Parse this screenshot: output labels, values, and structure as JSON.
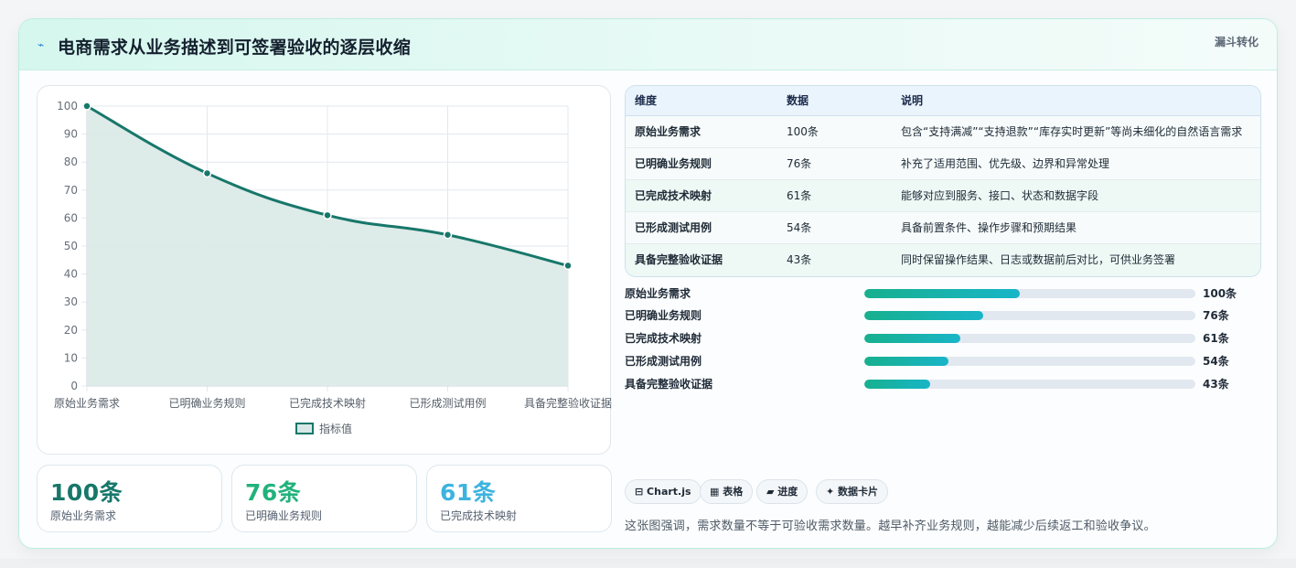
{
  "header": {
    "icon": "lightning-icon",
    "title": "电商需求从业务描述到可签署验收的逐层收缩",
    "tag": "漏斗转化"
  },
  "chart_data": {
    "type": "line",
    "categories": [
      "原始业务需求",
      "已明确业务规则",
      "已完成技术映射",
      "已形成测试用例",
      "具备完整验收证据"
    ],
    "series": [
      {
        "name": "指标值",
        "values": [
          100,
          76,
          61,
          54,
          43
        ]
      }
    ],
    "ylim": [
      0,
      100
    ],
    "yticks": [
      0,
      10,
      20,
      30,
      40,
      50,
      60,
      70,
      80,
      90,
      100
    ],
    "fill": true,
    "grid": true,
    "legend": "bottom",
    "colors": {
      "line": "#17776a",
      "fill": "#dbeae8"
    }
  },
  "stats": [
    {
      "num": "100条",
      "label": "原始业务需求",
      "color": "#17776a"
    },
    {
      "num": "76条",
      "label": "已明确业务规则",
      "color": "#21b27c"
    },
    {
      "num": "61条",
      "label": "已完成技术映射",
      "color": "#3db3df"
    }
  ],
  "table": {
    "headers": [
      "维度",
      "数据",
      "说明"
    ],
    "rows": [
      [
        "原始业务需求",
        "100条",
        "包含“支持满减”“支持退款”“库存实时更新”等尚未细化的自然语言需求"
      ],
      [
        "已明确业务规则",
        "76条",
        "补充了适用范围、优先级、边界和异常处理"
      ],
      [
        "已完成技术映射",
        "61条",
        "能够对应到服务、接口、状态和数据字段"
      ],
      [
        "已形成测试用例",
        "54条",
        "具备前置条件、操作步骤和预期结果"
      ],
      [
        "具备完整验收证据",
        "43条",
        "同时保留操作结果、日志或数据前后对比，可供业务签署"
      ]
    ]
  },
  "progress": [
    {
      "label": "原始业务需求",
      "value": "100条",
      "fraction": 0.47
    },
    {
      "label": "已明确业务规则",
      "value": "76条",
      "fraction": 0.36
    },
    {
      "label": "已完成技术映射",
      "value": "61条",
      "fraction": 0.29
    },
    {
      "label": "已形成测试用例",
      "value": "54条",
      "fraction": 0.255
    },
    {
      "label": "具备完整验收证据",
      "value": "43条",
      "fraction": 0.2
    }
  ],
  "chips": [
    "⊟ Chart.js",
    "▦ 表格",
    "▰ 进度",
    "✦ 数据卡片"
  ],
  "note": "这张图强调，需求数量不等于可验收需求数量。越早补齐业务规则，越能减少后续返工和验收争议。"
}
